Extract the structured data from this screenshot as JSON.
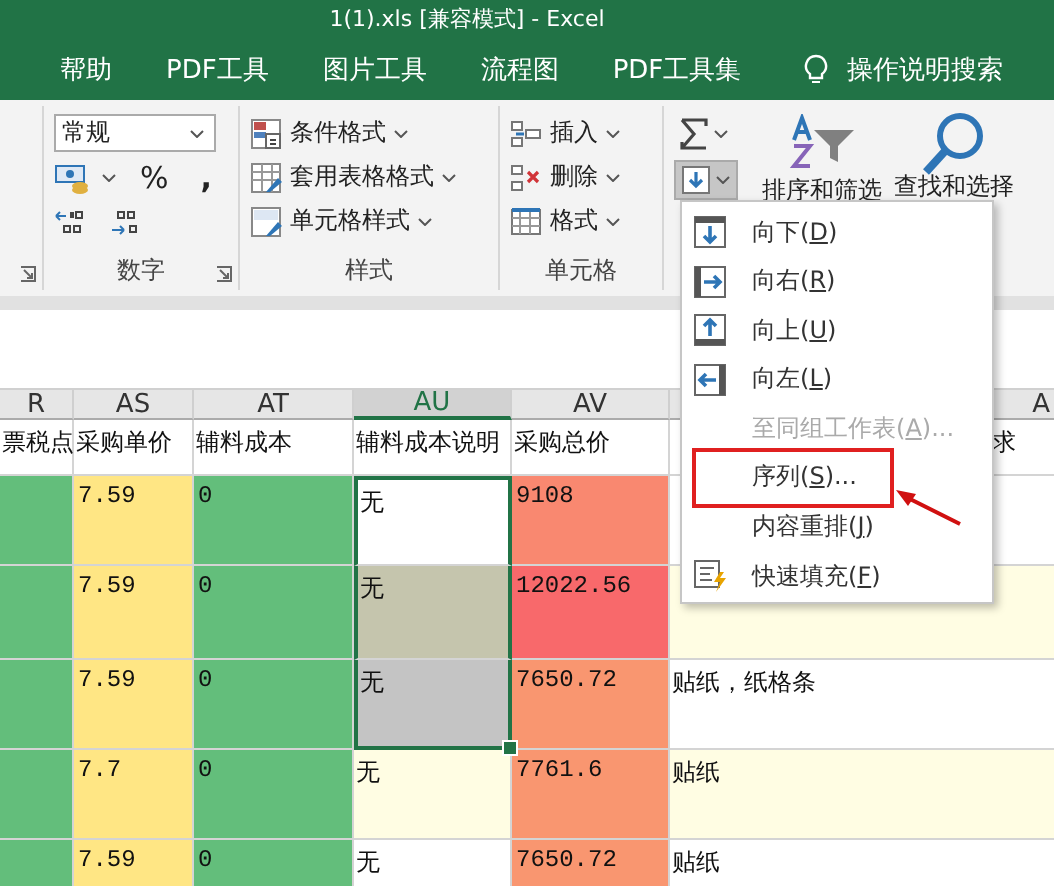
{
  "window": {
    "title": "1(1).xls  [兼容模式]  -  Excel"
  },
  "tabs": [
    {
      "label": "帮助"
    },
    {
      "label": "PDF工具"
    },
    {
      "label": "图片工具"
    },
    {
      "label": "流程图"
    },
    {
      "label": "PDF工具集"
    }
  ],
  "search": {
    "label": "操作说明搜索"
  },
  "ribbon": {
    "groups": [
      {
        "kind": "partial"
      },
      {
        "kind": "number",
        "label": "数字",
        "format": "常规",
        "percent": "%",
        "comma": ","
      },
      {
        "kind": "list",
        "label": "样式",
        "items": [
          {
            "label": "条件格式",
            "kind": "conditional"
          },
          {
            "label": "套用表格格式",
            "kind": "table"
          },
          {
            "label": "单元格样式",
            "kind": "cellstyle"
          }
        ]
      },
      {
        "kind": "list",
        "label": "单元格",
        "items": [
          {
            "label": "插入",
            "kind": "insert"
          },
          {
            "label": "删除",
            "kind": "delete"
          },
          {
            "label": "格式",
            "kind": "format"
          }
        ]
      },
      {
        "kind": "editing",
        "fill_pressed": true,
        "sort_label": "排序和筛选",
        "find_label": "查找和选择"
      }
    ]
  },
  "sheet": {
    "columns": [
      {
        "label": "R",
        "selected": false
      },
      {
        "label": "AS",
        "selected": false
      },
      {
        "label": "AT",
        "selected": false
      },
      {
        "label": "AU",
        "selected": true
      },
      {
        "label": "AV",
        "selected": false
      },
      {
        "label": "A",
        "selected": false
      }
    ],
    "rows": [
      {
        "cells": [
          {
            "text": "票税点",
            "color": "#ffffff",
            "selected": false
          },
          {
            "text": "采购单价",
            "color": "#ffffff",
            "selected": false
          },
          {
            "text": "辅料成本",
            "color": "#ffffff",
            "selected": false
          },
          {
            "text": "辅料成本说明",
            "color": "#ffffff",
            "selected": false
          },
          {
            "text": "采购总价",
            "color": "#ffffff",
            "selected": false
          },
          {
            "text": "求",
            "color": "#ffffff",
            "selected": false
          }
        ]
      },
      {
        "cells": [
          {
            "color": "#63be7b",
            "selected": false
          },
          {
            "text": "7.59",
            "color": "#ffe684",
            "selected": false
          },
          {
            "text": "0",
            "color": "#63be7b",
            "selected": false
          },
          {
            "text": "无",
            "color": "#ffffff",
            "selected": true
          },
          {
            "text": "9108",
            "color": "#f98870",
            "selected": false
          },
          {
            "color": "#ffffff",
            "selected": false
          }
        ]
      },
      {
        "cells": [
          {
            "color": "#63be7b",
            "selected": false
          },
          {
            "text": "7.59",
            "color": "#ffe684",
            "selected": false
          },
          {
            "text": "0",
            "color": "#63be7b",
            "selected": false
          },
          {
            "text": "无",
            "color": "#c5c5ad",
            "selected": true
          },
          {
            "text": "12022.56",
            "color": "#f8696b",
            "selected": false
          },
          {
            "color": "#fffde3",
            "selected": false
          }
        ]
      },
      {
        "cells": [
          {
            "color": "#63be7b",
            "selected": false
          },
          {
            "text": "7.59",
            "color": "#ffe684",
            "selected": false
          },
          {
            "text": "0",
            "color": "#63be7b",
            "selected": false
          },
          {
            "text": "无",
            "color": "#c4c4c4",
            "selected": true
          },
          {
            "text": "7650.72",
            "color": "#f99670",
            "selected": false
          },
          {
            "text": "贴纸，纸格条",
            "color": "#ffffff",
            "selected": false
          }
        ]
      },
      {
        "cells": [
          {
            "color": "#63be7b",
            "selected": false
          },
          {
            "text": "7.7",
            "color": "#ffe684",
            "selected": false
          },
          {
            "text": "0",
            "color": "#63be7b",
            "selected": false
          },
          {
            "text": "无",
            "color": "#fffde3",
            "selected": false
          },
          {
            "text": "7761.6",
            "color": "#f99670",
            "selected": false
          },
          {
            "text": "贴纸",
            "color": "#fffde3",
            "selected": false
          }
        ]
      },
      {
        "cells": [
          {
            "color": "#63be7b",
            "selected": false
          },
          {
            "text": "7.59",
            "color": "#ffe684",
            "selected": false
          },
          {
            "text": "0",
            "color": "#63be7b",
            "selected": false
          },
          {
            "text": "无",
            "color": "#ffffff",
            "selected": false
          },
          {
            "text": "7650.72",
            "color": "#f99670",
            "selected": false
          },
          {
            "text": "贴纸",
            "color": "#ffffff",
            "selected": false
          }
        ]
      }
    ]
  },
  "fill_menu": {
    "items": [
      {
        "kind": "down",
        "before": "向下(",
        "key": "D",
        "after": ")",
        "disabled": false,
        "highlighted": false
      },
      {
        "kind": "right",
        "before": "向右(",
        "key": "R",
        "after": ")",
        "disabled": false,
        "highlighted": false
      },
      {
        "kind": "up",
        "before": "向上(",
        "key": "U",
        "after": ")",
        "disabled": false,
        "highlighted": false
      },
      {
        "kind": "left",
        "before": "向左(",
        "key": "L",
        "after": ")",
        "disabled": false,
        "highlighted": false
      },
      {
        "kind": "none",
        "before": "至同组工作表(",
        "key": "A",
        "after": ")...",
        "disabled": true,
        "highlighted": false
      },
      {
        "kind": "none",
        "before": "序列(",
        "key": "S",
        "after": ")...",
        "disabled": false,
        "highlighted": true
      },
      {
        "kind": "none",
        "before": "内容重排(",
        "key": "J",
        "after": ")",
        "disabled": false,
        "highlighted": false
      },
      {
        "kind": "flash",
        "before": "快速填充(",
        "key": "F",
        "after": ")",
        "disabled": false,
        "highlighted": false
      }
    ]
  }
}
